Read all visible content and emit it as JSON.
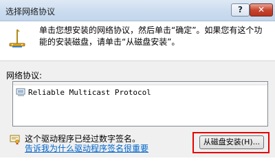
{
  "window": {
    "title": "选择网络协议",
    "help_button": "?",
    "close_button": "✕"
  },
  "info": {
    "text": "单击您想安装的网络协议，然后单击“确定”。如果您有这个功能的安装磁盘，请单击“从磁盘安装”。",
    "icon": "network-protocol-icon"
  },
  "protocols": {
    "label": "网络协议:",
    "items": [
      {
        "name": "Reliable Multicast Protocol",
        "icon": "protocol-item-icon"
      }
    ]
  },
  "footer": {
    "signed_text": "这个驱动程序已经过数字签名。",
    "signed_link": "告诉我为什么驱动程序签名很重要",
    "signed_icon": "certificate-icon",
    "install_from_disk": "从磁盘安装(H)..."
  },
  "colors": {
    "highlight": "#e60000",
    "link": "#0066cc"
  }
}
